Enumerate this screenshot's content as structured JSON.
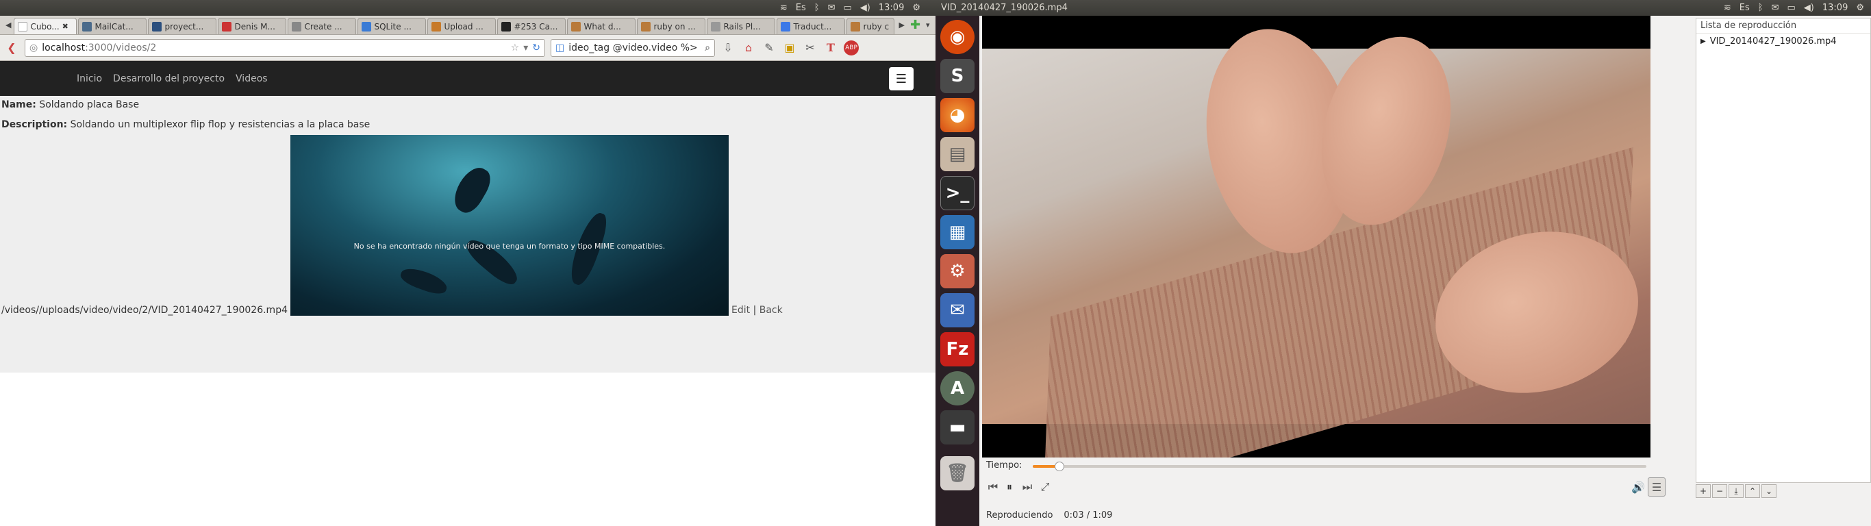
{
  "left_panel": {
    "time": "13:09"
  },
  "right_panel": {
    "title": "VID_20140427_190026.mp4",
    "time": "13:09"
  },
  "tabs": [
    "Cubo...",
    "MailCat...",
    "proyect...",
    "Denis M...",
    "Create ...",
    "SQLite ...",
    "Upload ...",
    "#253 Ca...",
    "What d...",
    "ruby on ...",
    "Rails Pl...",
    "Traduct...",
    "ruby c"
  ],
  "url": {
    "host": "localhost",
    "path": ":3000/videos/2"
  },
  "search": {
    "value": "ideo_tag @video.video %>"
  },
  "site_nav": [
    "Inicio",
    "Desarrollo del proyecto",
    "Videos"
  ],
  "page": {
    "name_label": "Name:",
    "name": "Soldando placa Base",
    "desc_label": "Description:",
    "desc": "Soldando un multiplexor flip flop y resistencias a la placa base",
    "video_msg": "No se ha encontrado ningún vídeo que tenga un formato y tipo MIME compatibles.",
    "path": "/videos//uploads/video/video/2/VID_20140427_190026.mp4",
    "edit": "Edit",
    "sep": "|",
    "back": "Back"
  },
  "vlc": {
    "playlist_title": "Lista de reproducción",
    "playlist_item": "VID_20140427_190026.mp4",
    "tiempo_label": "Tiempo:",
    "status": "Reproduciendo",
    "time": "0:03 / 1:09",
    "progress": 0.044
  },
  "launcher": [
    "ubuntu-icon",
    "sublime-icon",
    "firefox-icon",
    "files-icon",
    "terminal-icon",
    "writer-icon",
    "settings-icon",
    "thunderbird-icon",
    "filezilla-icon",
    "software-updater-icon",
    "clapper-icon",
    "trash-icon"
  ]
}
